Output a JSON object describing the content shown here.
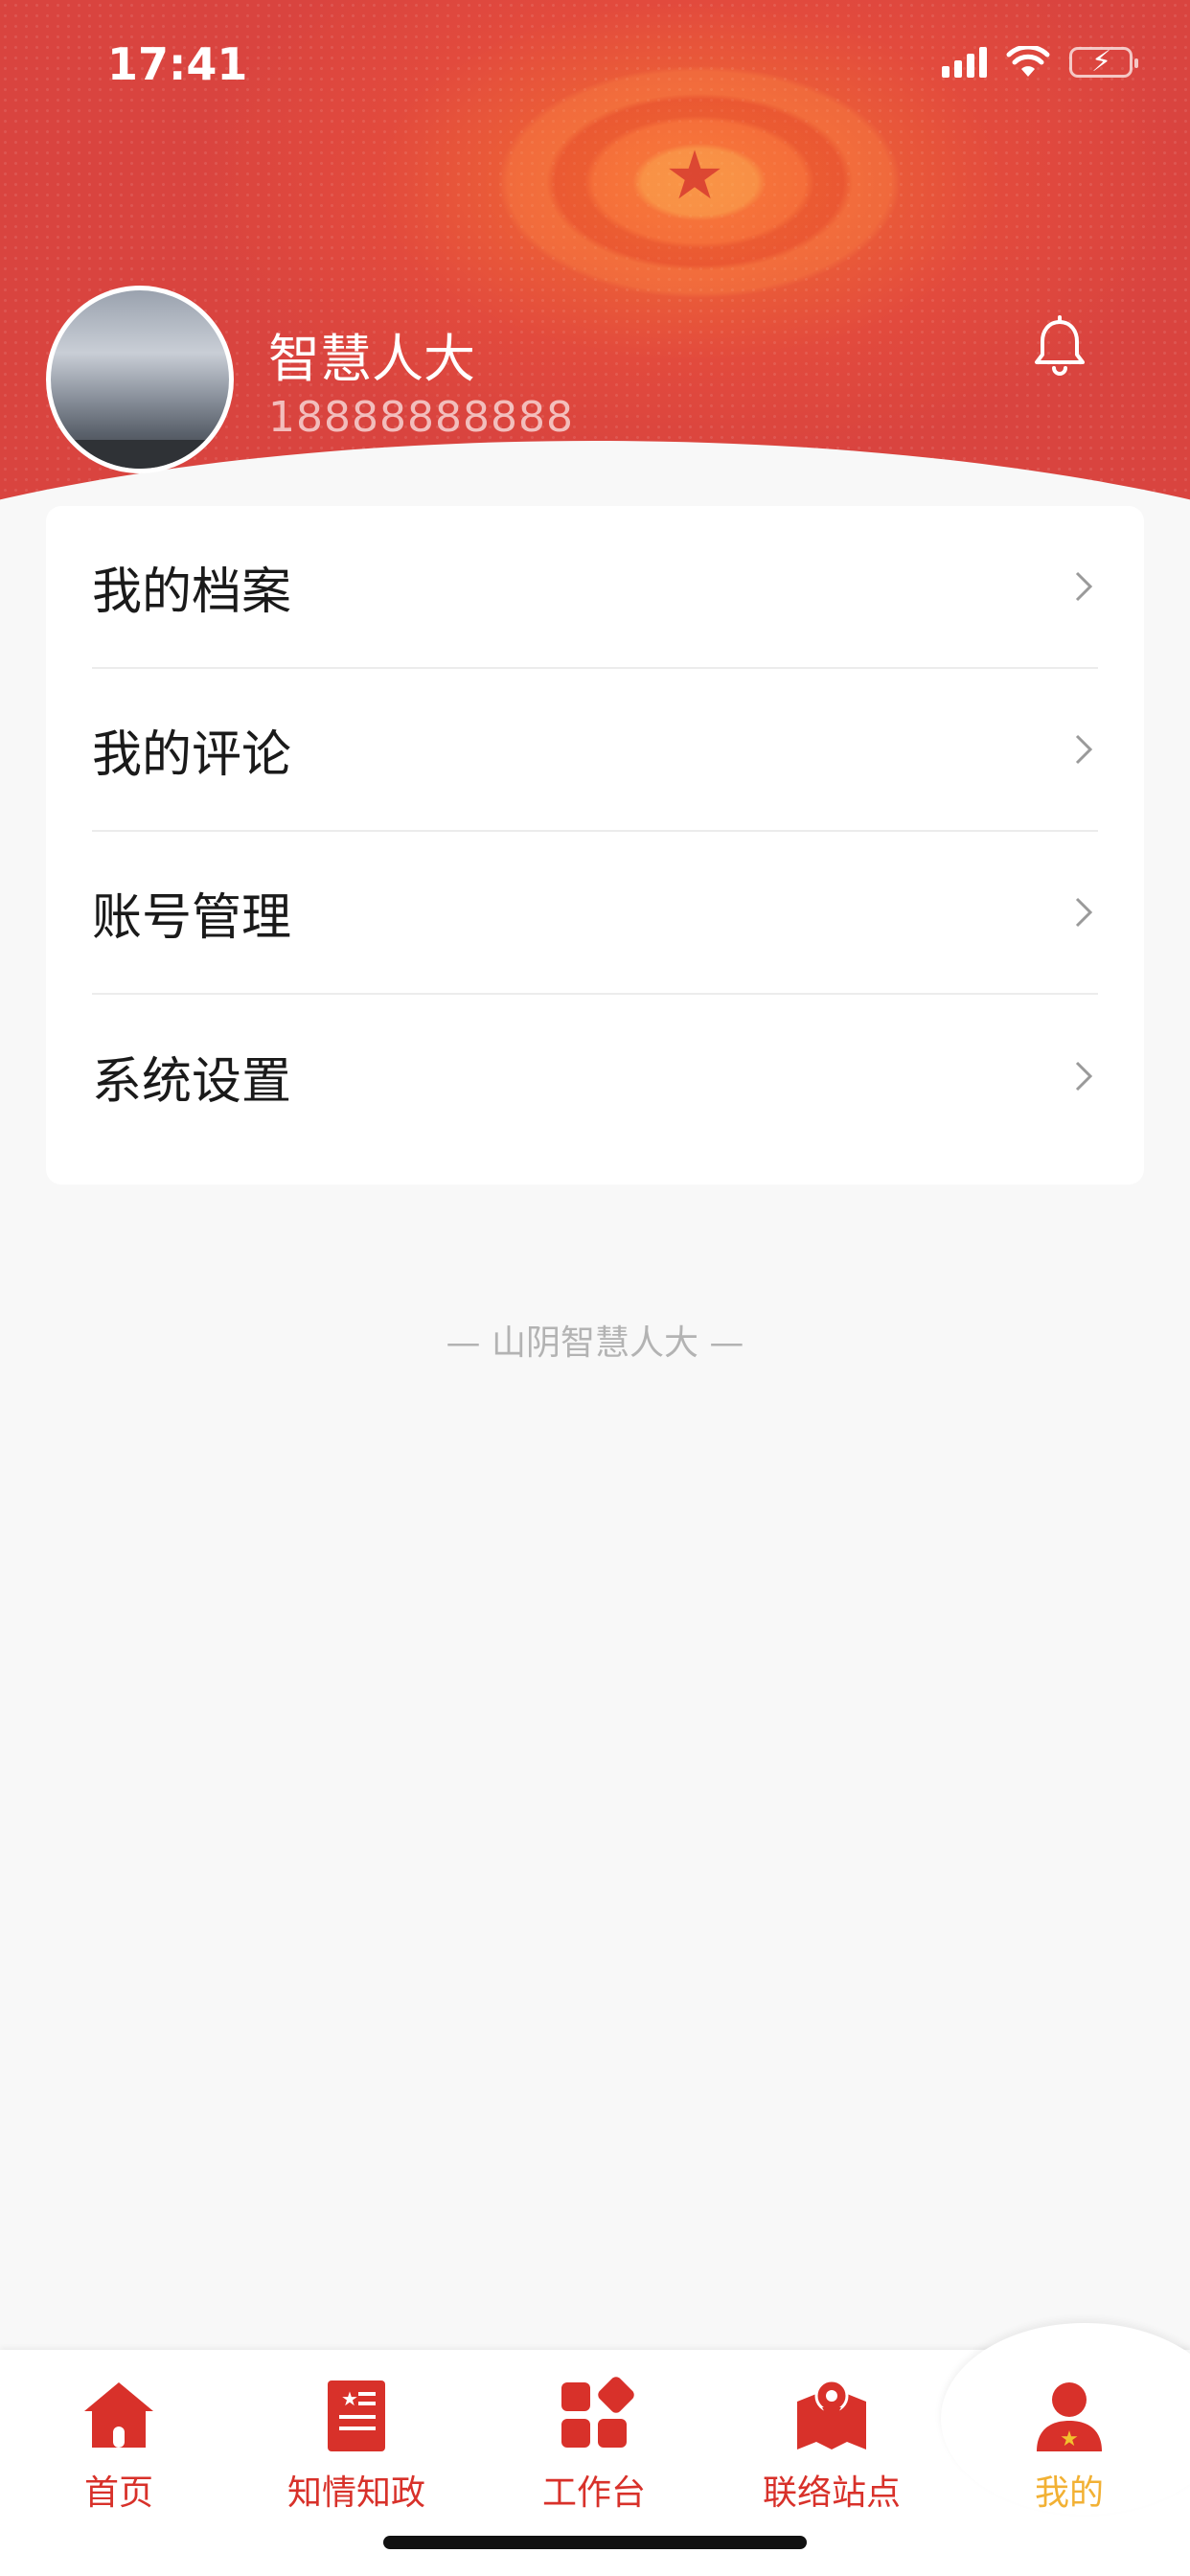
{
  "status_bar": {
    "time": "17:41"
  },
  "profile": {
    "name": "智慧人大",
    "phone": "18888888888",
    "notification_icon": "bell-icon"
  },
  "menu": {
    "items": [
      {
        "label": "我的档案",
        "icon": "chevron-right-icon"
      },
      {
        "label": "我的评论",
        "icon": "chevron-right-icon"
      },
      {
        "label": "账号管理",
        "icon": "chevron-right-icon"
      },
      {
        "label": "系统设置",
        "icon": "chevron-right-icon"
      }
    ]
  },
  "footer": {
    "brand": "— 山阴智慧人大 —"
  },
  "tabbar": {
    "items": [
      {
        "label": "首页",
        "icon": "home-icon"
      },
      {
        "label": "知情知政",
        "icon": "news-document-icon"
      },
      {
        "label": "工作台",
        "icon": "apps-grid-icon"
      },
      {
        "label": "联络站点",
        "icon": "map-location-icon"
      },
      {
        "label": "我的",
        "icon": "user-profile-icon"
      }
    ],
    "active_index": 4
  },
  "colors": {
    "primary_red": "#d8312a",
    "active_tab": "#f2b134",
    "header_red": "#d9443f"
  }
}
